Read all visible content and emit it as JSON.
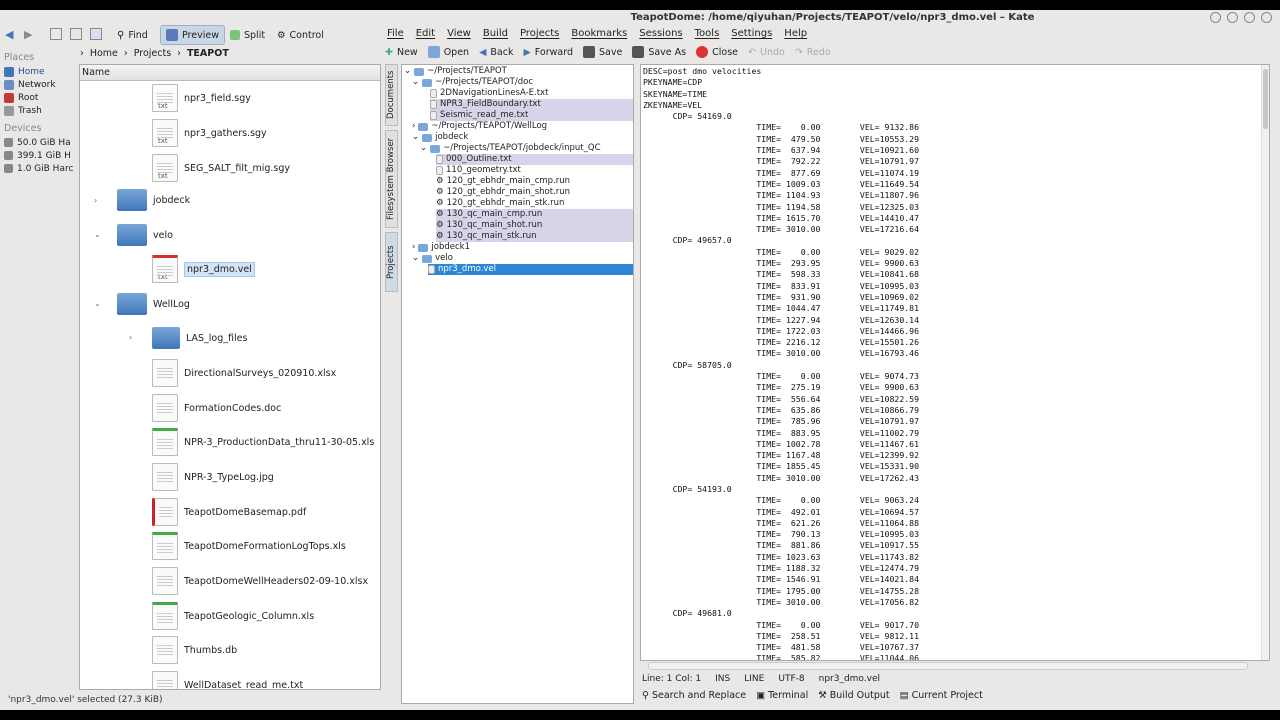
{
  "dolphin": {
    "toolbar": {
      "find": "Find",
      "preview": "Preview",
      "split": "Split",
      "control": "Control"
    },
    "places_header": "Places",
    "places": [
      {
        "label": "Home"
      },
      {
        "label": "Network"
      },
      {
        "label": "Root"
      },
      {
        "label": "Trash"
      }
    ],
    "devices_header": "Devices",
    "devices": [
      {
        "label": "50.0 GiB Ha"
      },
      {
        "label": "399.1 GiB H"
      },
      {
        "label": "1.0 GiB Harc"
      }
    ],
    "breadcrumb": {
      "home": "Home",
      "projects": "Projects",
      "teapot": "TEAPOT"
    },
    "column_name": "Name",
    "files": [
      {
        "name": "npr3_field.sgy"
      },
      {
        "name": "npr3_gathers.sgy"
      },
      {
        "name": "SEG_SALT_filt_mig.sgy"
      },
      {
        "name": "jobdeck"
      },
      {
        "name": "velo"
      },
      {
        "name": "npr3_dmo.vel"
      },
      {
        "name": "WellLog"
      },
      {
        "name": "LAS_log_files"
      },
      {
        "name": "DirectionalSurveys_020910.xlsx"
      },
      {
        "name": "FormationCodes.doc"
      },
      {
        "name": "NPR-3_ProductionData_thru11-30-05.xls"
      },
      {
        "name": "NPR-3_TypeLog.jpg"
      },
      {
        "name": "TeapotDomeBasemap.pdf"
      },
      {
        "name": "TeapotDomeFormationLogTops.xls"
      },
      {
        "name": "TeapotDomeWellHeaders02-09-10.xlsx"
      },
      {
        "name": "TeapotGeologic_Column.xls"
      },
      {
        "name": "Thumbs.db"
      },
      {
        "name": "WellDataset_read_me.txt"
      }
    ],
    "status": "'npr3_dmo.vel' selected (27.3 KiB)"
  },
  "kate": {
    "title": "TeapotDome: /home/qiyuhan/Projects/TEAPOT/velo/npr3_dmo.vel – Kate",
    "menu": [
      "File",
      "Edit",
      "View",
      "Build",
      "Projects",
      "Bookmarks",
      "Sessions",
      "Tools",
      "Settings",
      "Help"
    ],
    "toolbar": {
      "new": "New",
      "open": "Open",
      "back": "Back",
      "forward": "Forward",
      "save": "Save",
      "save_as": "Save As",
      "close": "Close",
      "undo": "Undo",
      "redo": "Redo"
    },
    "side_tabs": {
      "documents": "Documents",
      "filesystem": "Filesystem Browser",
      "projects": "Projects"
    },
    "project_tree": [
      {
        "label": "~/Projects/TEAPOT"
      },
      {
        "label": "~/Projects/TEAPOT/doc"
      },
      {
        "label": "2DNavigationLinesA-E.txt"
      },
      {
        "label": "NPR3_FieldBoundary.txt"
      },
      {
        "label": "Seismic_read_me.txt"
      },
      {
        "label": "~/Projects/TEAPOT/WellLog"
      },
      {
        "label": "jobdeck"
      },
      {
        "label": "~/Projects/TEAPOT/jobdeck/input_QC"
      },
      {
        "label": "000_Outline.txt"
      },
      {
        "label": "110_geometry.txt"
      },
      {
        "label": "120_gt_ebhdr_main_cmp.run"
      },
      {
        "label": "120_gt_ebhdr_main_shot.run"
      },
      {
        "label": "120_gt_ebhdr_main_stk.run"
      },
      {
        "label": "130_qc_main_cmp.run"
      },
      {
        "label": "130_qc_main_shot.run"
      },
      {
        "label": "130_qc_main_stk.run"
      },
      {
        "label": "jobdeck1"
      },
      {
        "label": "velo"
      },
      {
        "label": "npr3_dmo.vel"
      }
    ],
    "editor_text": "DESC=post dmo velocities\nPKEYNAME=CDP\nSKEYNAME=TIME\nZKEYNAME=VEL\n      CDP= 54169.0\n                       TIME=    0.00        VEL= 9132.86\n                       TIME=  479.50        VEL=10553.29\n                       TIME=  637.94        VEL=10921.60\n                       TIME=  792.22        VEL=10791.97\n                       TIME=  877.69        VEL=11074.19\n                       TIME= 1009.03        VEL=11649.54\n                       TIME= 1104.93        VEL=11807.96\n                       TIME= 1194.58        VEL=12325.03\n                       TIME= 1615.70        VEL=14410.47\n                       TIME= 3010.00        VEL=17216.64\n      CDP= 49657.0\n                       TIME=    0.00        VEL= 9029.02\n                       TIME=  293.95        VEL= 9900.63\n                       TIME=  598.33        VEL=10841.68\n                       TIME=  833.91        VEL=10995.03\n                       TIME=  931.90        VEL=10969.02\n                       TIME= 1044.47        VEL=11749.81\n                       TIME= 1227.94        VEL=12630.14\n                       TIME= 1722.03        VEL=14466.96\n                       TIME= 2216.12        VEL=15501.26\n                       TIME= 3010.00        VEL=16793.46\n      CDP= 58705.0\n                       TIME=    0.00        VEL= 9074.73\n                       TIME=  275.19        VEL= 9900.63\n                       TIME=  556.64        VEL=10822.59\n                       TIME=  635.86        VEL=10866.79\n                       TIME=  785.96        VEL=10791.97\n                       TIME=  883.95        VEL=11002.79\n                       TIME= 1002.78        VEL=11467.61\n                       TIME= 1167.48        VEL=12399.92\n                       TIME= 1855.45        VEL=15331.90\n                       TIME= 3010.00        VEL=17262.43\n      CDP= 54193.0\n                       TIME=    0.00        VEL= 9063.24\n                       TIME=  492.01        VEL=10694.57\n                       TIME=  621.26        VEL=11064.88\n                       TIME=  790.13        VEL=10995.03\n                       TIME=  881.86        VEL=10917.55\n                       TIME= 1023.63        VEL=11743.82\n                       TIME= 1188.32        VEL=12474.79\n                       TIME= 1546.91        VEL=14021.84\n                       TIME= 1795.00        VEL=14755.28\n                       TIME= 3010.00        VEL=17056.82\n      CDP= 49681.0\n                       TIME=    0.00        VEL= 9017.70\n                       TIME=  258.51        VEL= 9812.11\n                       TIME=  481.58        VEL=10767.37\n                       TIME=  585.82        VEL=11044.06",
    "status": {
      "position": "Line: 1 Col: 1",
      "ins": "INS",
      "line": "LINE",
      "encoding": "UTF-8",
      "filename": "npr3_dmo.vel"
    },
    "bottom_tabs": {
      "search": "Search and Replace",
      "terminal": "Terminal",
      "build": "Build Output",
      "project": "Current Project"
    },
    "colors": {
      "selection": "#2d86d6",
      "highlight": "#d9d3ea",
      "panel": "#e9e8e6"
    }
  }
}
